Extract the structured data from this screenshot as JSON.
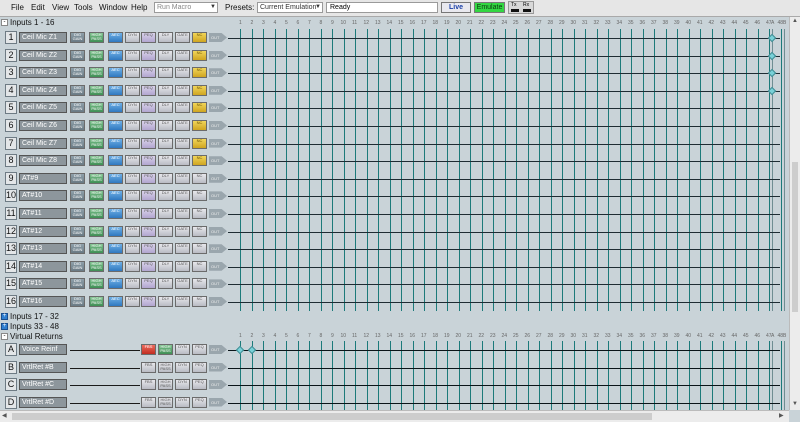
{
  "menu": [
    "File",
    "Edit",
    "View",
    "Tools",
    "Window",
    "Help"
  ],
  "toolbar": {
    "macro_value": "Run Macro",
    "presets_label": "Presets:",
    "presets_value": "Current Emulation",
    "status": "Ready",
    "live_label": "Live",
    "emulate_label": "Emulate",
    "tx_label": "Tx",
    "rx_label": "Rx"
  },
  "sections": {
    "inputs_1_16": "Inputs 1 - 16",
    "inputs_17_32": "Inputs 17 - 32",
    "inputs_33_48": "Inputs 33 - 48",
    "virtual_returns": "Virtual Returns"
  },
  "inputs": [
    {
      "num": "1",
      "name": "Ceil Mic Z1"
    },
    {
      "num": "2",
      "name": "Ceil Mic Z2"
    },
    {
      "num": "3",
      "name": "Ceil Mic Z3"
    },
    {
      "num": "4",
      "name": "Ceil Mic Z4"
    },
    {
      "num": "5",
      "name": "Ceil Mic Z5"
    },
    {
      "num": "6",
      "name": "Ceil Mic Z6"
    },
    {
      "num": "7",
      "name": "Ceil Mic Z7"
    },
    {
      "num": "8",
      "name": "Ceil Mic Z8"
    },
    {
      "num": "9",
      "name": "AT#9"
    },
    {
      "num": "10",
      "name": "AT#10"
    },
    {
      "num": "11",
      "name": "AT#11"
    },
    {
      "num": "12",
      "name": "AT#12"
    },
    {
      "num": "13",
      "name": "AT#13"
    },
    {
      "num": "14",
      "name": "AT#14"
    },
    {
      "num": "15",
      "name": "AT#15"
    },
    {
      "num": "16",
      "name": "AT#16"
    }
  ],
  "virtual_returns": [
    {
      "letter": "A",
      "name": "Voice Reinf"
    },
    {
      "letter": "B",
      "name": "VrtlRet #B"
    },
    {
      "letter": "C",
      "name": "VrtlRet #C"
    },
    {
      "letter": "D",
      "name": "VrtlRet #D"
    }
  ],
  "blocks": {
    "dig": "DIG GAIN",
    "hp": "HIGH PASS",
    "aec": "AEC",
    "dyn": "DYN",
    "eq": "PEQ",
    "grey": "DLY",
    "yel": "NC",
    "gate": "GATE",
    "fbs": "FBS",
    "out": "OUT"
  },
  "matrix_ticks": [
    "1",
    "2",
    "3",
    "4",
    "5",
    "6",
    "7",
    "8",
    "9",
    "10",
    "11",
    "12",
    "13",
    "14",
    "15",
    "16",
    "17",
    "18",
    "19",
    "20",
    "21",
    "22",
    "23",
    "24",
    "25",
    "26",
    "27",
    "28",
    "29",
    "30",
    "31",
    "32",
    "33",
    "34",
    "35",
    "36",
    "37",
    "38",
    "39",
    "40",
    "41",
    "42",
    "43",
    "44",
    "45",
    "46",
    "47",
    "48",
    "A",
    "B"
  ]
}
